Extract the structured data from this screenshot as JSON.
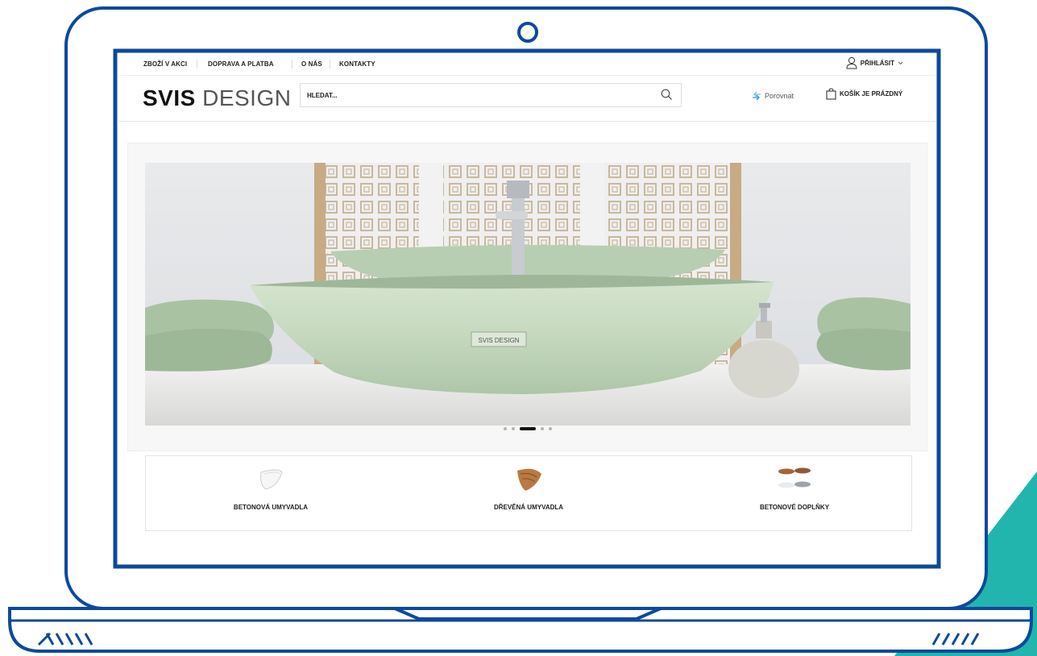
{
  "topnav": {
    "links": [
      "ZBOŽÍ V AKCI",
      "DOPRAVA A PLATBA",
      "O NÁS",
      "KONTAKTY"
    ],
    "login_label": "PŘIHLÁSIT"
  },
  "header": {
    "logo_bold": "SVIS",
    "logo_light": "DESIGN",
    "search_placeholder": "HLEDAT...",
    "compare_label": "Porovnat",
    "cart_label": "KOŠÍK JE PRÁZDNÝ"
  },
  "hero": {
    "sink_label": "SVIS DESIGN",
    "slide_count": 5,
    "active_slide": 3
  },
  "categories": [
    {
      "label": "BETONOVÁ UMYVADLA",
      "icon": "white-basin-icon"
    },
    {
      "label": "DŘEVĚNÁ UMYVADLA",
      "icon": "wooden-basin-icon"
    },
    {
      "label": "BETONOVÉ DOPLŇKY",
      "icon": "concrete-accessories-icon"
    }
  ],
  "colors": {
    "frame": "#0b4a9c",
    "teal_accent": "#22b5ad",
    "sink_green": "#c9dcc4",
    "compare_icon": "#3a8fd8"
  }
}
